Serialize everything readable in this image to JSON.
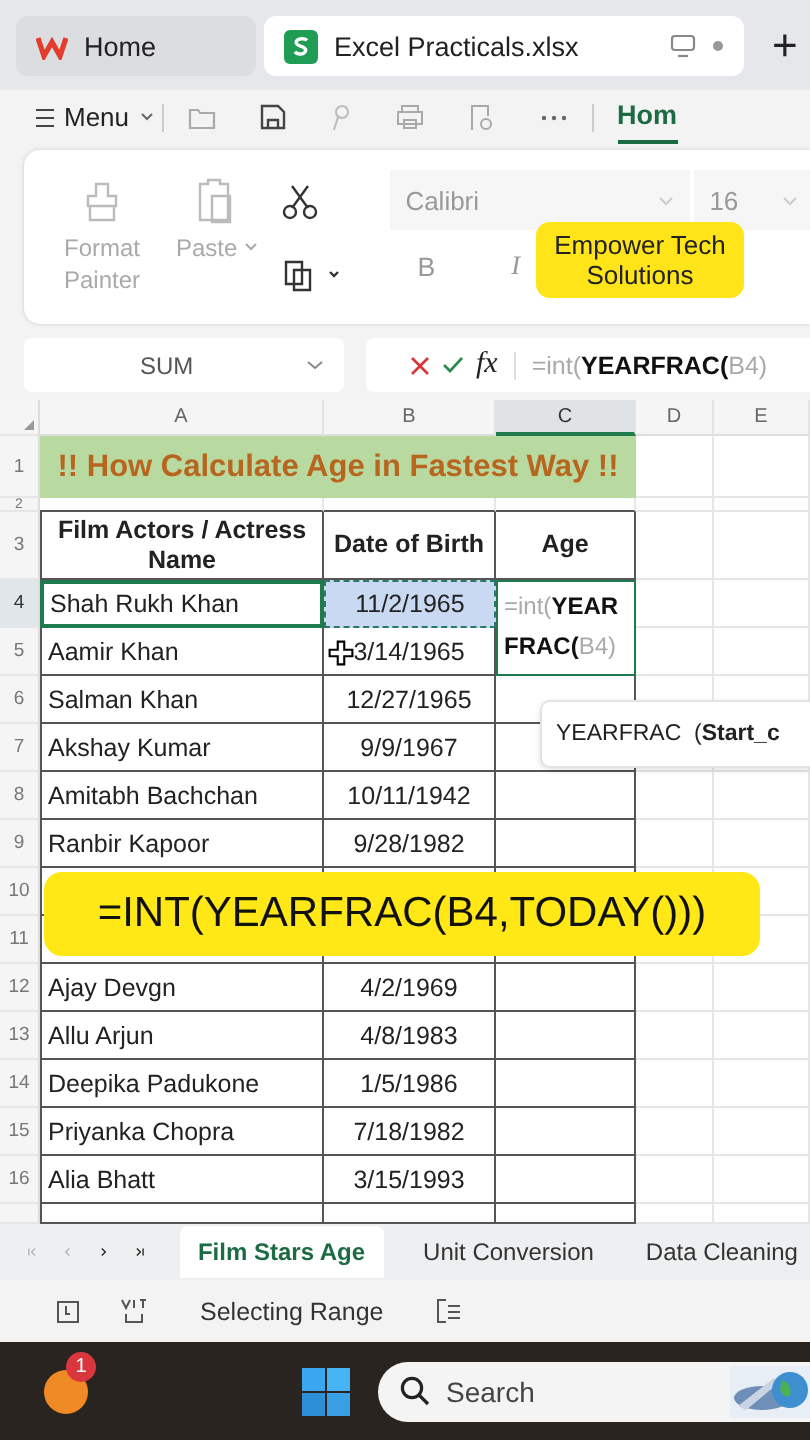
{
  "title_tabs": [
    {
      "label": "Home",
      "selected": false,
      "kind": "home"
    },
    {
      "label": "Excel Practicals.xlsx",
      "selected": true,
      "kind": "sheet"
    }
  ],
  "new_tab": "+",
  "menu_bar": {
    "menu": "Menu",
    "tab": {
      "label": "Hom",
      "selected": true
    }
  },
  "ribbon": {
    "format_painter": "Format Painter",
    "paste": "Paste",
    "font": "Calibri",
    "font_size": "16",
    "bold": "B",
    "italic": "I"
  },
  "overlay_label": "Empower Tech Solutions",
  "name_box": "SUM",
  "formula_bar": {
    "function_symbol": "fx",
    "formula": "=int(**YEARFRAC(**B4)"
  },
  "columns": [
    {
      "label": "A",
      "selected": false
    },
    {
      "label": "B",
      "selected": false
    },
    {
      "label": "C",
      "selected": true
    },
    {
      "label": "D",
      "selected": false
    },
    {
      "label": "E",
      "selected": false
    }
  ],
  "sheet": {
    "top_row_numbers": [
      "1",
      "2",
      "3"
    ],
    "title": "!! How Calculate Age in Fastest Way !!",
    "headers": [
      "Film Actors / Actress Name",
      "Date of Birth",
      "Age"
    ],
    "rows": [
      {
        "number": "4",
        "name": "Shah Rukh Khan",
        "dob": "11/2/1965",
        "selected": true
      },
      {
        "number": "5",
        "name": "Aamir Khan",
        "dob": "3/14/1965",
        "selected": false
      },
      {
        "number": "6",
        "name": "Salman Khan",
        "dob": "12/27/1965",
        "selected": false
      },
      {
        "number": "7",
        "name": "Akshay Kumar",
        "dob": "9/9/1967",
        "selected": false
      },
      {
        "number": "8",
        "name": "Amitabh Bachchan",
        "dob": "10/11/1942",
        "selected": false
      },
      {
        "number": "9",
        "name": "Ranbir Kapoor",
        "dob": "9/28/1982",
        "selected": false
      },
      {
        "number": "10",
        "selected": false
      },
      {
        "number": "11",
        "selected": false
      },
      {
        "number": "12",
        "name": "Ajay Devgn",
        "dob": "4/2/1969",
        "selected": false
      },
      {
        "number": "13",
        "name": "Allu Arjun",
        "dob": "4/8/1983",
        "selected": false
      },
      {
        "number": "14",
        "name": "Deepika Padukone",
        "dob": "1/5/1986",
        "selected": false
      },
      {
        "number": "15",
        "name": "Priyanka Chopra",
        "dob": "7/18/1982",
        "selected": false
      },
      {
        "number": "16",
        "name": "Alia Bhatt",
        "dob": "3/15/1993",
        "selected": false
      }
    ],
    "editing_cell": "=int(**YEARFRAC(**B4)"
  },
  "tooltip": "YEARFRAC  (**Start_c**",
  "banner": "=INT(YEARFRAC(B4,TODAY()))",
  "sheet_tabs": [
    {
      "label": "Film Stars Age",
      "selected": true
    },
    {
      "label": "Unit Conversion",
      "selected": false
    },
    {
      "label": "Data Cleaning",
      "selected": false
    }
  ],
  "status_bar": {
    "mode": "Selecting Range"
  },
  "taskbar": {
    "badge": "1",
    "search": {
      "placeholder": "Search"
    }
  }
}
